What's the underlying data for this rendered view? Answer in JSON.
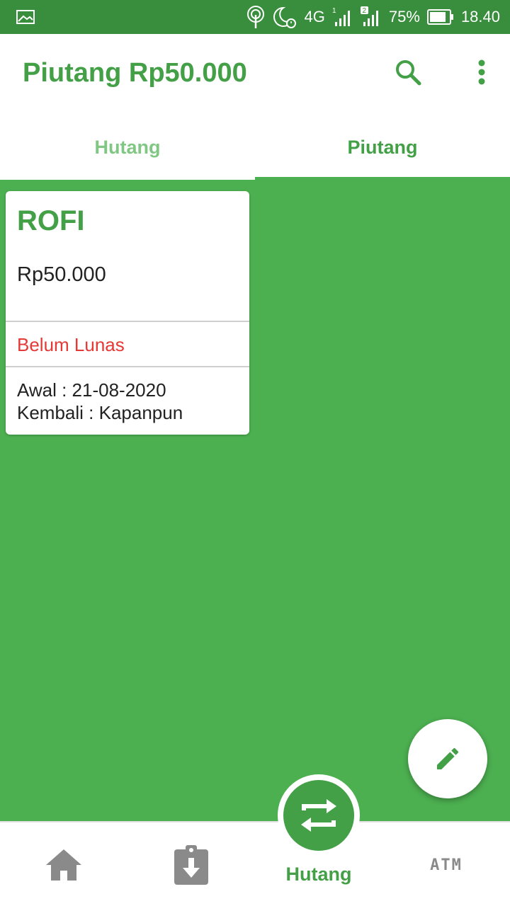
{
  "status_bar": {
    "network": "4G",
    "sim1": "1",
    "sim2": "2",
    "battery": "75%",
    "time": "18.40"
  },
  "header": {
    "title": "Piutang Rp50.000",
    "search_icon": "search-icon",
    "more_icon": "more-vert-icon"
  },
  "tabs": [
    {
      "label": "Hutang",
      "active": false
    },
    {
      "label": "Piutang",
      "active": true
    }
  ],
  "cards": [
    {
      "name": "ROFI",
      "amount": "Rp50.000",
      "status": "Belum Lunas",
      "start": "Awal : 21-08-2020",
      "return": "Kembali : Kapanpun"
    }
  ],
  "fab": {
    "icon": "edit-icon"
  },
  "bottom_nav": {
    "items": [
      {
        "icon": "home-icon"
      },
      {
        "icon": "download-clipboard-icon"
      },
      {
        "icon": "swap-icon",
        "label": "Hutang"
      },
      {
        "icon": "atm-icon",
        "label": "ATM"
      }
    ]
  },
  "colors": {
    "primary": "#43a047",
    "background": "#4caf50",
    "status_red": "#e53935",
    "status_bar": "#388e3c"
  }
}
